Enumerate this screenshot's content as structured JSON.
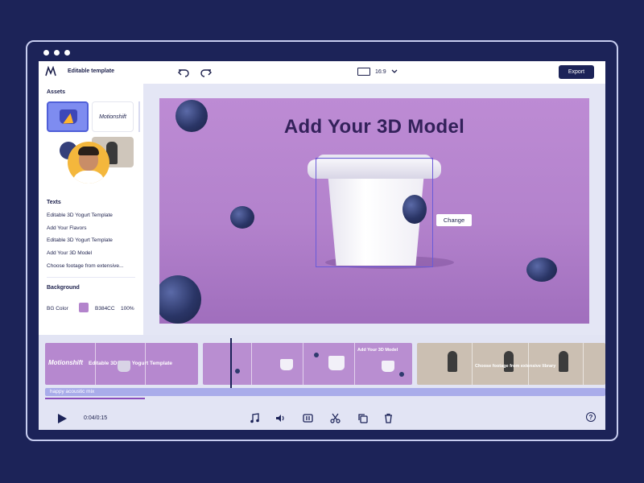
{
  "toolbar": {
    "title": "Editable template",
    "aspect_ratio": "16:9",
    "export_label": "Export"
  },
  "assets": {
    "heading": "Assets",
    "logo_text": "Motionshift"
  },
  "texts": {
    "heading": "Texts",
    "items": [
      "Editable 3D Yogurt Template",
      "Add Your Flavors",
      "Editable 3D Yogurt Template",
      "Add Your 3D Model",
      "Choose footage from extensive..."
    ]
  },
  "background": {
    "heading": "Background",
    "label": "BG Color",
    "hex": "B384CC",
    "opacity": "100%",
    "color": "#b384cc"
  },
  "canvas": {
    "title": "Add Your 3D Model",
    "change_label": "Change"
  },
  "timeline": {
    "clip_a_text": "Motionshift",
    "clip_a_text2": "Editable 3D & 3D Yogurt Template",
    "clip_b_text": "Add Your 3D Model",
    "clip_c_text": "Choose footage from extensive library",
    "audio_label": "happy acoustic mix",
    "current_time": "0:04/0:15"
  },
  "colors": {
    "background": "#1c2358",
    "accent": "#1c2358",
    "canvas": "#b384cc"
  }
}
